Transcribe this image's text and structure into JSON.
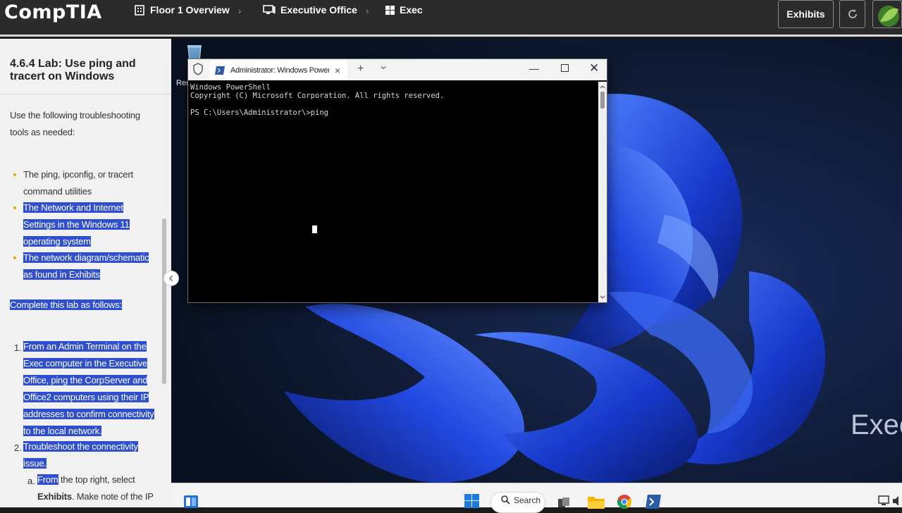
{
  "app": {
    "brand": "CompTIA"
  },
  "breadcrumb": {
    "items": [
      {
        "label": "Floor 1 Overview",
        "icon": "building-icon"
      },
      {
        "label": "Executive Office",
        "icon": "computer-monitor-icon"
      },
      {
        "label": "Exec",
        "icon": "windows-logo-icon"
      }
    ]
  },
  "toolbar": {
    "exhibits_label": "Exhibits"
  },
  "lab": {
    "title": "4.6.4 Lab: Use ping and tracert on Windows",
    "intro": "Use the following troubleshooting tools as needed:",
    "tools": [
      "The ping, ipconfig, or tracert command utilities",
      "The Network and Internet Settings in the Windows 11 operating system",
      "The network diagram/schematic as found in Exhibits"
    ],
    "instructions_heading": "Complete this lab as follows:",
    "steps": [
      {
        "num": "1.",
        "text": "From an Admin Terminal on the Exec computer in the Executive Office, ping the CorpServer and Office2 computers using their IP addresses to confirm connectivity to the local network."
      },
      {
        "num": "2.",
        "text": "Troubleshoot the connectivity issue."
      }
    ],
    "substep": {
      "letter": "a.",
      "text_start": "From",
      "text_rest": " the top right, select",
      "text_bold": "Exhibits",
      "text_end": ". Make note of the IP"
    }
  },
  "desktop": {
    "computer_label": "Exec",
    "recycle_label": "Rec"
  },
  "terminal": {
    "tab_title": "Administrator: Windows PowerShell",
    "output": "Windows PowerShell\nCopyright (C) Microsoft Corporation. All rights reserved.\n\nPS C:\\Users\\Administrator\\>ping"
  },
  "taskbar": {
    "search_label": "Search"
  },
  "colors": {
    "topbar_bg": "#2b2b2b",
    "highlight": "#2f4fcf",
    "bullet": "#e8a200",
    "terminal_bg": "#000000"
  }
}
